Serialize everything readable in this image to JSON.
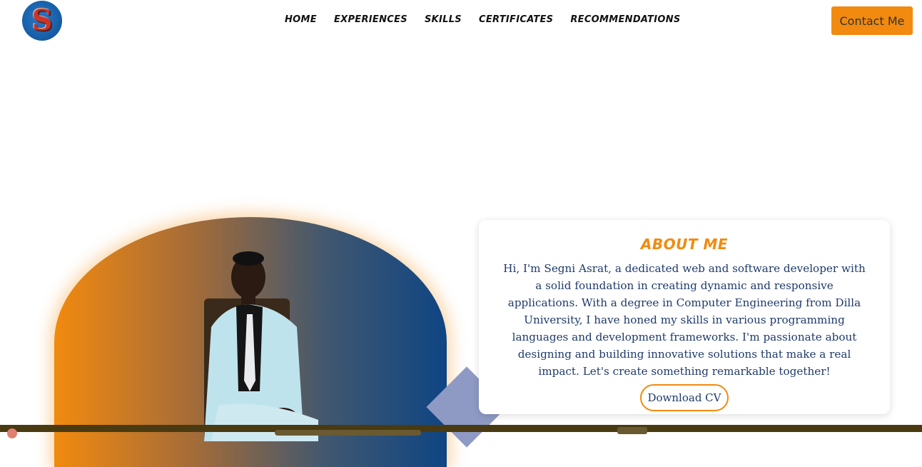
{
  "header": {
    "logo_letter": "S",
    "nav": [
      "HOME",
      "EXPERIENCES",
      "SKILLS",
      "CERTIFICATES",
      "RECOMMENDATIONS"
    ],
    "contact_label": "Contact Me"
  },
  "about": {
    "title": "ABOUT ME",
    "text": "Hi, I'm Segni Asrat, a dedicated web and software developer with a solid foundation in creating dynamic and responsive applications. With a degree in Computer Engineering from Dilla University, I have honed my skills in various programming languages and development frameworks. I'm passionate about designing and building innovative solutions that make a real impact. Let's create something remarkable together!",
    "cv_label": "Download CV"
  },
  "colors": {
    "accent": "#f28a0f",
    "brand_blue": "#0f4583",
    "text": "#1e3a6a"
  }
}
